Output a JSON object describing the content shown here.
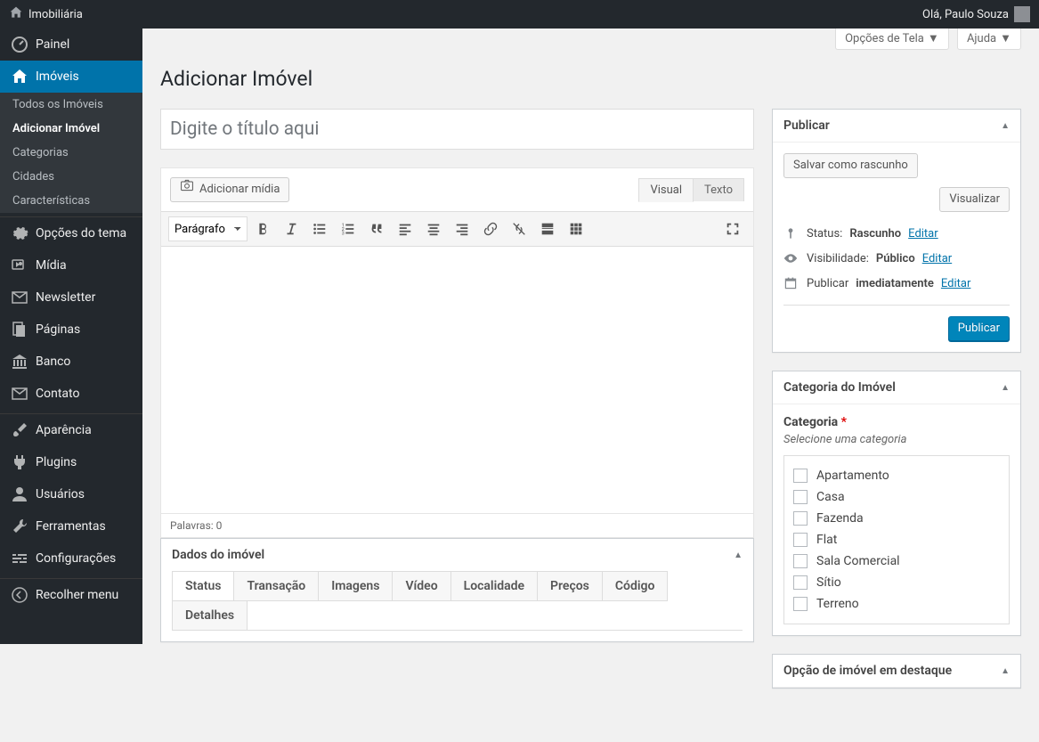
{
  "adminbar": {
    "site_name": "Imobiliária",
    "greeting": "Olá, Paulo Souza"
  },
  "screen_meta": {
    "options": "Opções de Tela",
    "help": "Ajuda"
  },
  "page": {
    "heading": "Adicionar Imóvel",
    "title_placeholder": "Digite o título aqui"
  },
  "menu": {
    "dashboard": "Painel",
    "imoveis": "Imóveis",
    "sub_todos": "Todos os Imóveis",
    "sub_add": "Adicionar Imóvel",
    "sub_cat": "Categorias",
    "sub_cid": "Cidades",
    "sub_car": "Características",
    "opcoes": "Opções do tema",
    "midia": "Mídia",
    "newsletter": "Newsletter",
    "paginas": "Páginas",
    "banco": "Banco",
    "contato": "Contato",
    "aparencia": "Aparência",
    "plugins": "Plugins",
    "usuarios": "Usuários",
    "ferramentas": "Ferramentas",
    "config": "Configurações",
    "recolher": "Recolher menu"
  },
  "editor": {
    "add_media": "Adicionar mídia",
    "tab_visual": "Visual",
    "tab_text": "Texto",
    "format_select": "Parágrafo",
    "word_count_label": "Palavras:",
    "word_count": "0"
  },
  "publish": {
    "box_title": "Publicar",
    "save_draft": "Salvar como rascunho",
    "preview": "Visualizar",
    "status_label": "Status:",
    "status_value": "Rascunho",
    "vis_label": "Visibilidade:",
    "vis_value": "Público",
    "sched_label": "Publicar",
    "sched_value": "imediatamente",
    "edit": "Editar",
    "publish_btn": "Publicar"
  },
  "catbox": {
    "title": "Categoria do Imóvel",
    "label": "Categoria",
    "help": "Selecione uma categoria",
    "items": [
      "Apartamento",
      "Casa",
      "Fazenda",
      "Flat",
      "Sala Comercial",
      "Sítio",
      "Terreno"
    ]
  },
  "featurebox": {
    "title": "Opção de imóvel em destaque"
  },
  "dadosbox": {
    "title": "Dados do imóvel",
    "tabs": [
      "Status",
      "Transação",
      "Imagens",
      "Vídeo",
      "Localidade",
      "Preços",
      "Código",
      "Detalhes"
    ]
  }
}
